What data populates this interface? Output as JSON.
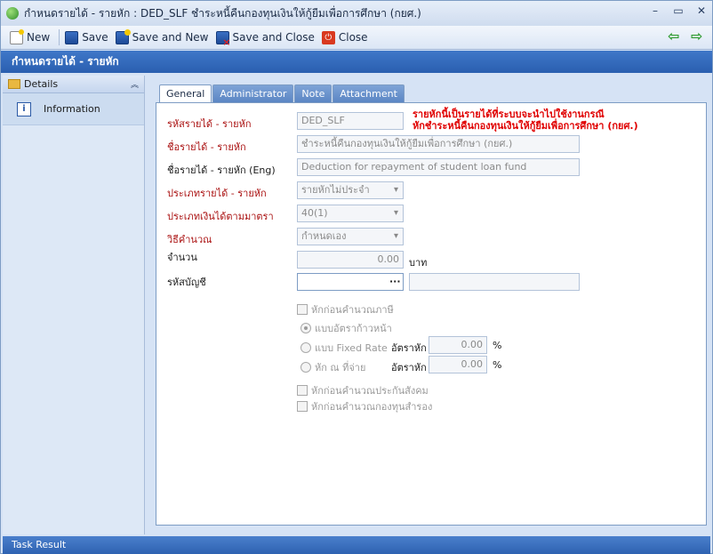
{
  "window": {
    "title": "กำหนดรายได้ - รายหัก : DED_SLF ชำระหนี้คืนกองทุนเงินให้กู้ยืมเพื่อการศึกษา (กยศ.)",
    "minimize": "–",
    "maximize": "▭",
    "close": "✕"
  },
  "toolbar": {
    "new_label": "New",
    "save_label": "Save",
    "save_new_label": "Save and New",
    "save_close_label": "Save and Close",
    "close_label": "Close"
  },
  "header": {
    "title": "กำหนดรายได้ - รายหัก"
  },
  "sidebar": {
    "section_label": "Details",
    "items": [
      {
        "label": "Information"
      }
    ]
  },
  "tabs": [
    {
      "label": "General"
    },
    {
      "label": "Administrator"
    },
    {
      "label": "Note"
    },
    {
      "label": "Attachment"
    }
  ],
  "form": {
    "code": {
      "label": "รหัสรายได้ - รายหัก",
      "value": "DED_SLF"
    },
    "warning_line1": "รายหักนี้เป็นรายได้ที่ระบบจะนำไปใช้งานกรณี",
    "warning_line2": "หักชำระหนี้คืนกองทุนเงินให้กู้ยืมเพื่อการศึกษา (กยศ.)",
    "name": {
      "label": "ชื่อรายได้ - รายหัก",
      "value": "ชำระหนี้คืนกองทุนเงินให้กู้ยืมเพื่อการศึกษา (กยศ.)"
    },
    "name_eng": {
      "label": "ชื่อรายได้ - รายหัก (Eng)",
      "value": "Deduction for repayment of student loan fund"
    },
    "type": {
      "label": "ประเภทรายได้ - รายหัก",
      "value": "รายหักไม่ประจำ"
    },
    "section": {
      "label": "ประเภทเงินได้ตามมาตรา",
      "value": "40(1)"
    },
    "calc": {
      "label": "วิธีคำนวณ",
      "value": "กำหนดเอง"
    },
    "amount": {
      "label": "จำนวน",
      "value": "0.00",
      "unit": "บาท"
    },
    "account": {
      "label": "รหัสบัญชี",
      "browse": "···",
      "value": ""
    },
    "tax_before": "หักก่อนคำนวณภาษี",
    "radio_progressive": "แบบอัตราก้าวหน้า",
    "radio_fixed": "แบบ Fixed Rate",
    "radio_withhold": "หัก ณ ที่จ่าย",
    "rate_label": "อัตราหัก",
    "rate_fixed": "0.00",
    "rate_withhold": "0.00",
    "pct": "%",
    "sso_before": "หักก่อนคำนวณประกันสังคม",
    "pf_before": "หักก่อนคำนวณกองทุนสำรอง"
  },
  "taskbar": {
    "label": "Task Result"
  }
}
